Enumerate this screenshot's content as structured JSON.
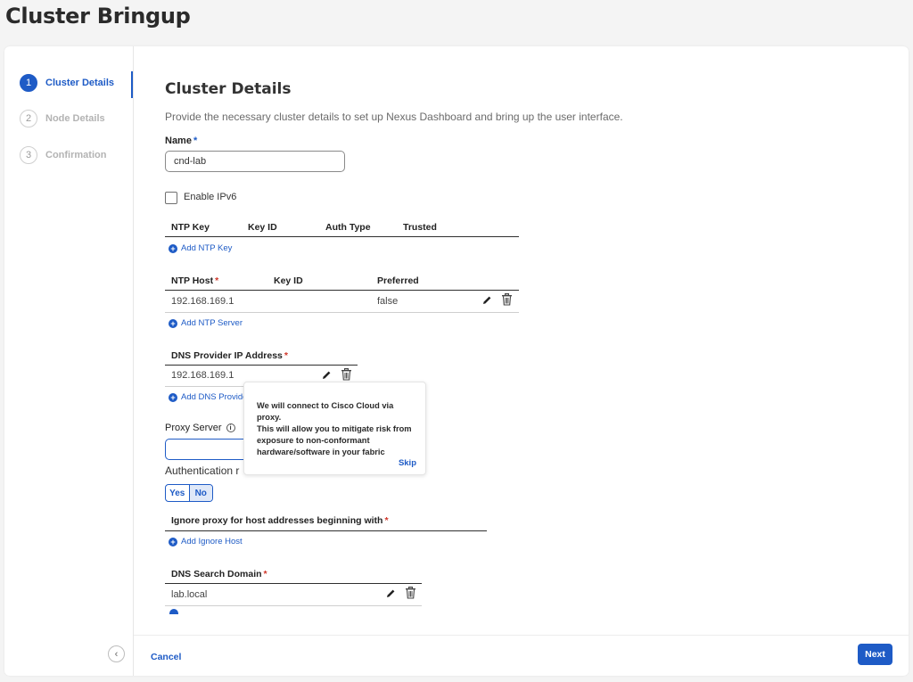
{
  "page": {
    "title": "Cluster Bringup"
  },
  "steps": [
    {
      "num": "1",
      "label": "Cluster Details"
    },
    {
      "num": "2",
      "label": "Node Details"
    },
    {
      "num": "3",
      "label": "Confirmation"
    }
  ],
  "form": {
    "section_title": "Cluster Details",
    "description": "Provide the necessary cluster details to set up Nexus Dashboard and bring up the user interface.",
    "name_label": "Name",
    "name_value": "cnd-lab",
    "enable_ipv6_label": "Enable IPv6",
    "ntp_key_table": {
      "headers": [
        "NTP Key",
        "Key ID",
        "Auth Type",
        "Trusted"
      ],
      "add_label": "Add NTP Key"
    },
    "ntp_host_table": {
      "headers": [
        "NTP Host",
        "Key ID",
        "Preferred"
      ],
      "rows": [
        {
          "host": "192.168.169.1",
          "key_id": "",
          "preferred": "false"
        }
      ],
      "add_label": "Add NTP Server"
    },
    "dns_provider_table": {
      "header": "DNS Provider IP Address",
      "rows": [
        {
          "ip": "192.168.169.1"
        }
      ],
      "add_label": "Add DNS Provide"
    },
    "proxy_server_label": "Proxy Server",
    "proxy_server_value": "",
    "authentication_label": "Authentication r",
    "auth_toggle": {
      "yes": "Yes",
      "no": "No",
      "selected": "No"
    },
    "ignore_proxy": {
      "header": "Ignore proxy for host addresses beginning with",
      "add_label": "Add Ignore Host"
    },
    "dns_search_domain": {
      "header": "DNS Search Domain",
      "rows": [
        {
          "domain": "lab.local"
        }
      ]
    }
  },
  "tooltip": {
    "lines": [
      "We will connect to Cisco Cloud via proxy.",
      "This will allow you to mitigate risk from",
      "exposure to non-conformant",
      "hardware/software in your fabric"
    ],
    "skip_label": "Skip"
  },
  "footer": {
    "cancel_label": "Cancel",
    "next_label": "Next"
  },
  "colors": {
    "accent": "#1e5bc6",
    "required": "#d0382b"
  }
}
